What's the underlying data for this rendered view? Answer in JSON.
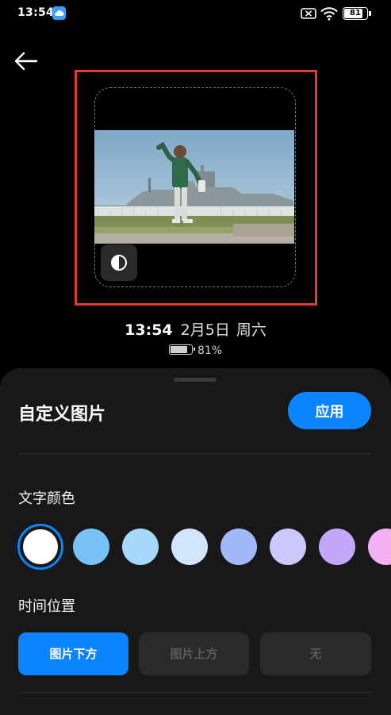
{
  "status_bar": {
    "time": "13:54",
    "battery_text": "81",
    "battery_level": 0.81
  },
  "preview": {
    "time": "13:54",
    "date": "2月5日",
    "weekday": "周六",
    "battery_percent": "81%",
    "battery_level": 0.81
  },
  "sheet": {
    "title": "自定义图片",
    "apply_label": "应用",
    "text_color_label": "文字颜色",
    "swatches": [
      {
        "name": "white",
        "color": "#ffffff",
        "selected": true
      },
      {
        "name": "sky-blue",
        "color": "#78c1f7"
      },
      {
        "name": "light-sky-blue",
        "color": "#a6d8fb"
      },
      {
        "name": "pale-blue",
        "color": "#d3e5fd"
      },
      {
        "name": "periwinkle",
        "color": "#a3b8f7"
      },
      {
        "name": "lavender",
        "color": "#cbc9fb"
      },
      {
        "name": "violet",
        "color": "#c3a7f9"
      },
      {
        "name": "pink",
        "color": "#f3b0f2"
      }
    ],
    "time_position_label": "时间位置",
    "position_options": [
      {
        "label": "图片下方",
        "active": true
      },
      {
        "label": "图片上方",
        "active": false
      },
      {
        "label": "无",
        "active": false
      }
    ]
  },
  "colors": {
    "accent": "#0d84ff",
    "highlight": "#e53935",
    "background": "#000000",
    "sheet": "#181818"
  }
}
